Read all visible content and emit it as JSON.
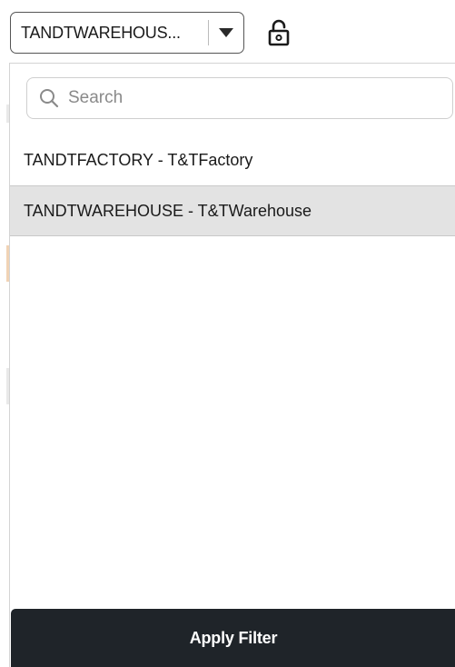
{
  "selector": {
    "value": "TANDTWAREHOUS...",
    "caret_icon": "caret-down-icon"
  },
  "lock": {
    "icon": "unlocked-padlock-icon"
  },
  "dropdown": {
    "search": {
      "icon": "search-icon",
      "placeholder": "Search",
      "value": ""
    },
    "options": [
      {
        "label": "TANDTFACTORY - T&TFactory",
        "selected": false
      },
      {
        "label": "TANDTWAREHOUSE - T&TWarehouse",
        "selected": true
      }
    ],
    "apply_label": "Apply Filter"
  },
  "colors": {
    "apply_bg": "#1f2429",
    "selected_row_bg": "#e3e3e3"
  }
}
